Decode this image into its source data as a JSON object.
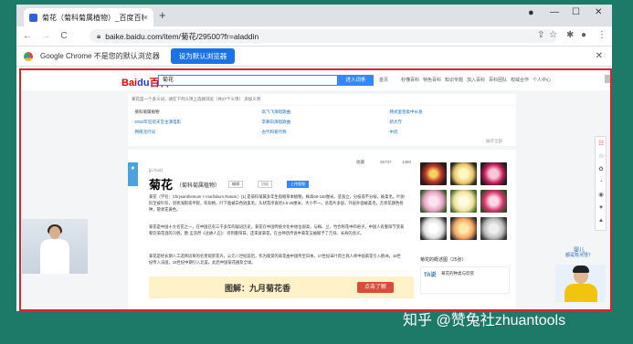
{
  "browser": {
    "tab_title": "菊花（菊科菊属植物）_百度百科",
    "tab_close": "×",
    "new_tab": "+",
    "minimize": "—",
    "maximize": "☐",
    "close": "✕",
    "url": "baike.baidu.com/item/菊花/29500?fr=aladdin",
    "back": "←",
    "forward": "→",
    "reload": "C"
  },
  "infobar": {
    "message": "Google Chrome 不是您的默认浏览器",
    "default_button": "设为默认浏览器",
    "close": "✕"
  },
  "baike": {
    "logo_a": "Bai",
    "logo_b": "du",
    "logo_c": "百科",
    "search_value": "菊花",
    "search_button": "进入词条",
    "top_links": [
      "首页",
      "秒懂百科",
      "特色百科",
      "知识专题",
      "加入百科",
      "百科团队",
      "权威合作",
      "个人中心"
    ],
    "notice": "菊花是一个多义词，请在下列义项上选择浏览（共27个义项）   添加义项",
    "disambiguation": [
      "·菊科菊属植物",
      "·2002年狂欢天堂主演电影",
      "·网络流行词",
      "·高飞飞演唱歌曲",
      "·李慕白演唱歌曲",
      "·古代和菊代称",
      "·韩式蛋卷类中长发",
      "·新大厅",
      "·中药"
    ],
    "expand_all": "展开全部",
    "pinyin": "[jú huā]",
    "stats": [
      "收藏",
      "26737",
      "1480"
    ],
    "title": "菊花",
    "subtitle": "（菊科菊属植物）",
    "toolbar": [
      "编辑",
      "讨论",
      "上传视频"
    ],
    "para1": "菊花（学名：Chrysanthemum × morifolium Ramat.）[1] 是菊科菊属多年生宿根草本植物。株高60-150厘米。茎直立，分枝或不分枝，被柔毛。叶卵形至披针形，羽状浅裂或半裂，有短柄，叶下面被白色短柔毛。头状花序直径2.5-20厘米，大小不一。总苞片多层，外层外面被柔毛。舌状花颜色各种，管状花黄色。",
    "para2": "菊花是中国十大名花之一，在中国已有三千多年的栽培历史。菊花在中国传统文化中地位很高，与梅、兰、竹合称花中四君子。中国人有重阳节赏菊和饮菊花酒的习俗。唐·孟浩然《过故人庄》：待到重阳日，还来就菊花。在古神话传说中菊花又被赋予了吉祥、长寿的含义。",
    "para3": "菊花是经长期人工选择培育的名贵观赏花卉，公元八世纪前后，作为观赏的菊花由中国传至日本。17世纪末叶荷兰商人将中国菊花引入欧洲，18世纪传入法国，19世纪中期引入北美。此后中国菊花遍及全球。",
    "gallery_caption": "菊花的概述图（25张）",
    "tadu_title": "TA说",
    "tadu_text": "菊花的种类与欣赏",
    "banner_text": "图解：九月菊花香",
    "banner_button": "点击了解",
    "side_icons": [
      "☷",
      "☆",
      "✿",
      "◔",
      "◉",
      "♥",
      "▲"
    ],
    "ad_name": "婴儿",
    "ad_sub": "都是有点怪？"
  },
  "watermark": "知乎 @赞兔社zhuantools",
  "colors": {
    "background": "#1e7a68",
    "accent": "#3388ff",
    "highlight_border": "#d9262c",
    "link": "#136ec2"
  }
}
